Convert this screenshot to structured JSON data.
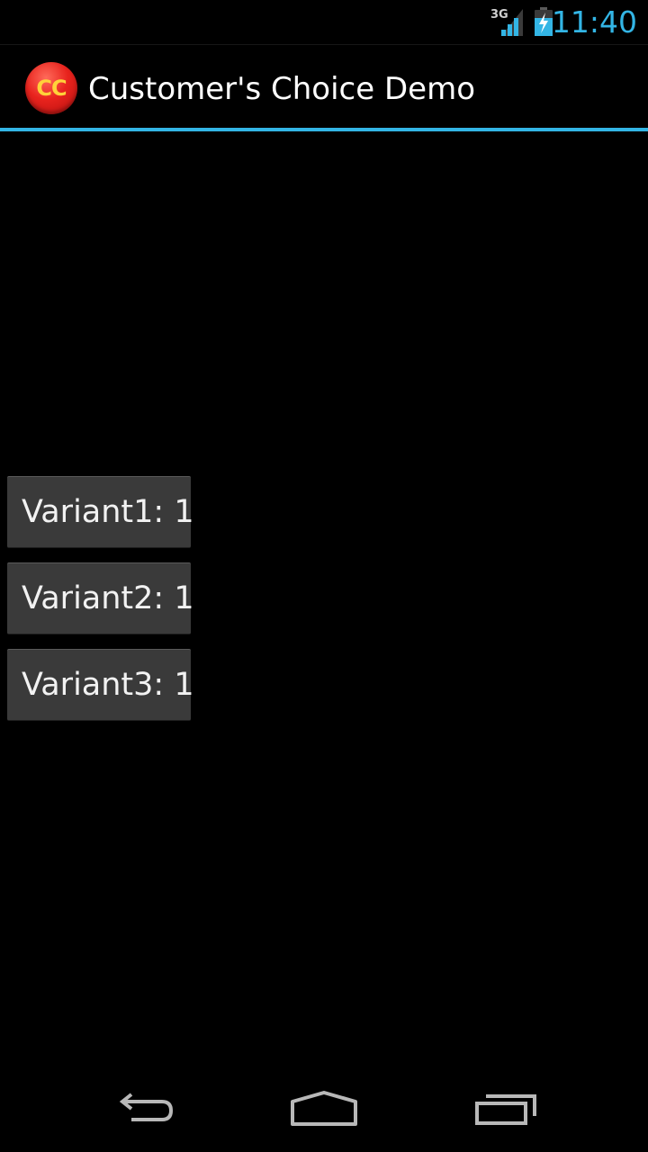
{
  "status_bar": {
    "network_type": "3G",
    "time": "11:40",
    "accent_color": "#33b5e5",
    "icons": [
      "signal-3g-icon",
      "battery-charging-icon"
    ]
  },
  "action_bar": {
    "app_icon_text": "CC",
    "title": "Customer's Choice Demo",
    "divider_color": "#33b5e5"
  },
  "buttons": [
    {
      "label": "Variant1: 1"
    },
    {
      "label": "Variant2: 1"
    },
    {
      "label": "Variant3: 1"
    }
  ],
  "nav_bar": {
    "icons": [
      "back-icon",
      "home-icon",
      "recent-apps-icon"
    ]
  }
}
